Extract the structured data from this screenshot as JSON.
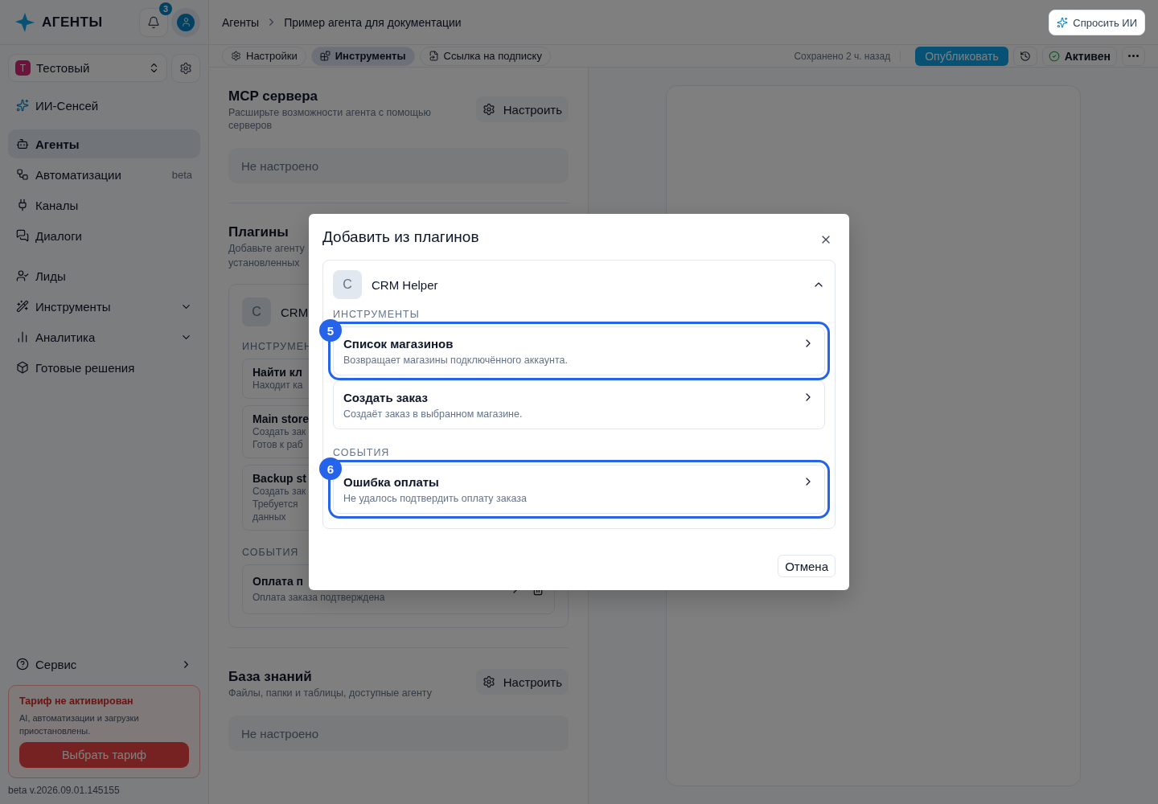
{
  "brand": {
    "name": "АГЕНТЫ"
  },
  "notifications": {
    "count": "3"
  },
  "workspace": {
    "initial": "Т",
    "name": "Тестовый"
  },
  "assistant_link": {
    "label": "ИИ-Сенсей"
  },
  "nav_groups": [
    [
      {
        "label": "Агенты",
        "selected": true,
        "expandable": false
      },
      {
        "label": "Автоматизации",
        "selected": false,
        "expandable": false,
        "tag": "beta"
      },
      {
        "label": "Каналы",
        "selected": false,
        "expandable": false
      },
      {
        "label": "Диалоги",
        "selected": false,
        "expandable": false
      }
    ],
    [
      {
        "label": "Лиды",
        "selected": false,
        "expandable": false
      },
      {
        "label": "Инструменты",
        "selected": false,
        "expandable": true
      },
      {
        "label": "Аналитика",
        "selected": false,
        "expandable": true
      },
      {
        "label": "Готовые решения",
        "selected": false,
        "expandable": false
      }
    ]
  ],
  "service": {
    "label": "Сервис"
  },
  "plan_alert": {
    "title": "Тариф не активирован",
    "text": "AI, автоматизации и загрузки приостановлены.",
    "button": "Выбрать тариф"
  },
  "version": "beta v.2026.09.01.145155",
  "breadcrumbs": [
    {
      "label": "Агенты"
    },
    {
      "label": "Пример агента для документации"
    }
  ],
  "ask_ai": {
    "label": "Спросить ИИ"
  },
  "toolbar": {
    "tabs": [
      {
        "label": "Настройки",
        "selected": false
      },
      {
        "label": "Инструменты",
        "selected": true
      },
      {
        "label": "Ссылка на подписку",
        "selected": false
      }
    ],
    "saved": "Сохранено 2 ч. назад",
    "publish": "Опубликовать",
    "status": "Активен"
  },
  "mcp": {
    "title": "MCP сервера",
    "description": "Расширьте возможности агента с помощью серверов",
    "button": "Настроить",
    "empty": "Не настроено"
  },
  "plugins": {
    "title": "Плагины",
    "description_lines": [
      "Добавьте агенту",
      "установленных"
    ],
    "card": {
      "initial": "C",
      "name": "CRM",
      "tools_label": "ИНСТРУМЕН",
      "tools": [
        {
          "title": "Найти кл",
          "lines": [
            "Находит ка"
          ]
        },
        {
          "title": "Main store",
          "lines": [
            "Создать зак",
            "Готов к раб"
          ]
        },
        {
          "title": "Backup st",
          "lines": [
            "Создать зак",
            "Требуется",
            "данных"
          ]
        }
      ],
      "events_label": "СОБЫТИЯ",
      "events": [
        {
          "title": "Оплата п",
          "description": "Оплата заказа подтверждена"
        }
      ]
    }
  },
  "knowledge": {
    "title": "База знаний",
    "description": "Файлы, папки и таблицы, доступные агенту",
    "button": "Настроить",
    "empty": "Не настроено"
  },
  "dialog": {
    "title": "Добавить из плагинов",
    "plugin": {
      "initial": "C",
      "name": "CRM Helper",
      "expanded": true,
      "sections": [
        {
          "label": "ИНСТРУМЕНТЫ",
          "items": [
            {
              "title": "Список магазинов",
              "description": "Возвращает магазины подключённого аккаунта.",
              "marker": "5"
            },
            {
              "title": "Создать заказ",
              "description": "Создаёт заказ в выбранном магазине."
            }
          ]
        },
        {
          "label": "СОБЫТИЯ",
          "items": [
            {
              "title": "Ошибка оплаты",
              "description": "Не удалось подтвердить оплату заказа",
              "marker": "6"
            }
          ]
        }
      ]
    },
    "cancel": "Отмена"
  }
}
